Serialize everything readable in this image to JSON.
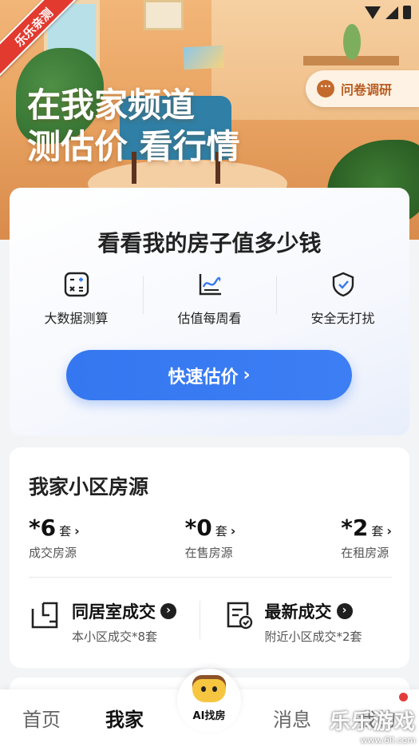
{
  "badge": "乐乐亲测",
  "hero": {
    "title_line1": "在我家频道",
    "title_line2": "测估价 看行情"
  },
  "survey_button": {
    "label": "问卷调研",
    "icon": "chat-dots-icon"
  },
  "valuation": {
    "title": "看看我的房子值多少钱",
    "features": [
      {
        "icon": "calculator-icon",
        "label": "大数据测算"
      },
      {
        "icon": "trend-chart-icon",
        "label": "估值每周看"
      },
      {
        "icon": "shield-check-icon",
        "label": "安全无打扰"
      }
    ],
    "button_label": "快速估价",
    "button_arrow": "›"
  },
  "housing": {
    "title": "我家小区房源",
    "stats": [
      {
        "value": "*6",
        "unit": "套",
        "arrow": "›",
        "label": "成交房源"
      },
      {
        "value": "*0",
        "unit": "套",
        "arrow": "›",
        "label": "在售房源"
      },
      {
        "value": "*2",
        "unit": "套",
        "arrow": "›",
        "label": "在租房源"
      }
    ],
    "deals": [
      {
        "icon": "floorplan-icon",
        "title": "同居室成交",
        "sub": "本小区成交*8套"
      },
      {
        "icon": "document-check-icon",
        "title": "最新成交",
        "sub": "附近小区成交*2套"
      }
    ],
    "deal_arrow": "›"
  },
  "nav": {
    "home": "首页",
    "mine": "我家",
    "ai": "AI找房",
    "messages": "消息",
    "me": "我的"
  },
  "watermark": {
    "main": "乐乐游戏",
    "url": "www.6ll.com"
  },
  "colors": {
    "primary": "#3477f0",
    "badge": "#e23a2f",
    "survey_text": "#b85d22"
  }
}
